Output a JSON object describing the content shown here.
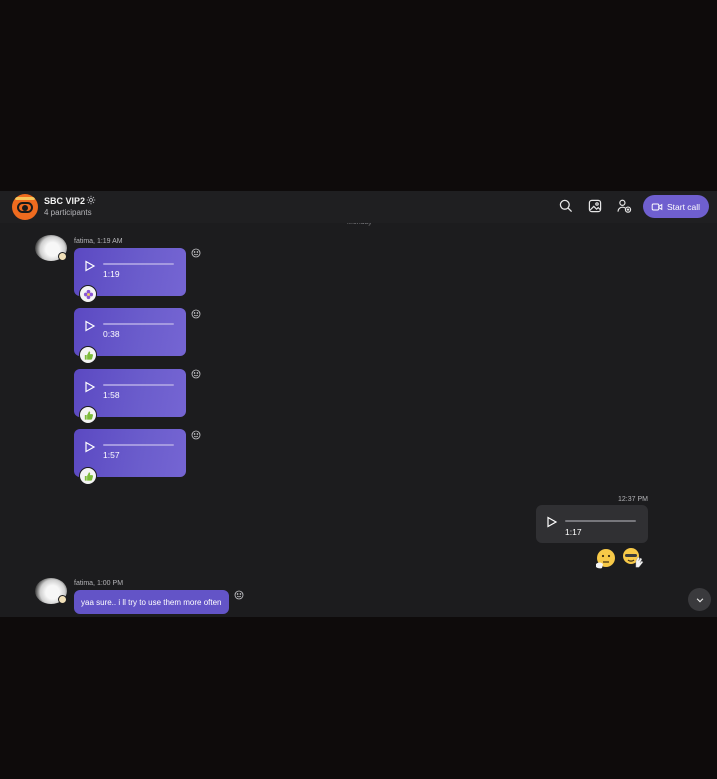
{
  "header": {
    "title": "SBC VIP2",
    "subtitle": "4 participants",
    "start_call_label": "Start call"
  },
  "day_label": "Monday",
  "messages": [
    {
      "sender": "fatima, 1:19 AM"
    },
    {
      "sender": "fatima, 1:00 PM"
    }
  ],
  "voice_messages": [
    {
      "duration": "1:19",
      "reaction": "flower"
    },
    {
      "duration": "0:38",
      "reaction": "thumbs-up"
    },
    {
      "duration": "1:58",
      "reaction": "thumbs-up"
    },
    {
      "duration": "1:57",
      "reaction": "thumbs-up"
    }
  ],
  "own_message": {
    "time": "12:37 PM",
    "duration": "1:17",
    "stickers": [
      "thinking-emoji",
      "waving-emoji"
    ]
  },
  "text_message": "yaa sure.. i ll try to use them more often",
  "colors": {
    "accent": "#6f5fcf",
    "bubble_incoming": "#5b49c2",
    "bubble_outgoing": "#303033",
    "background": "#1c1c1e"
  }
}
